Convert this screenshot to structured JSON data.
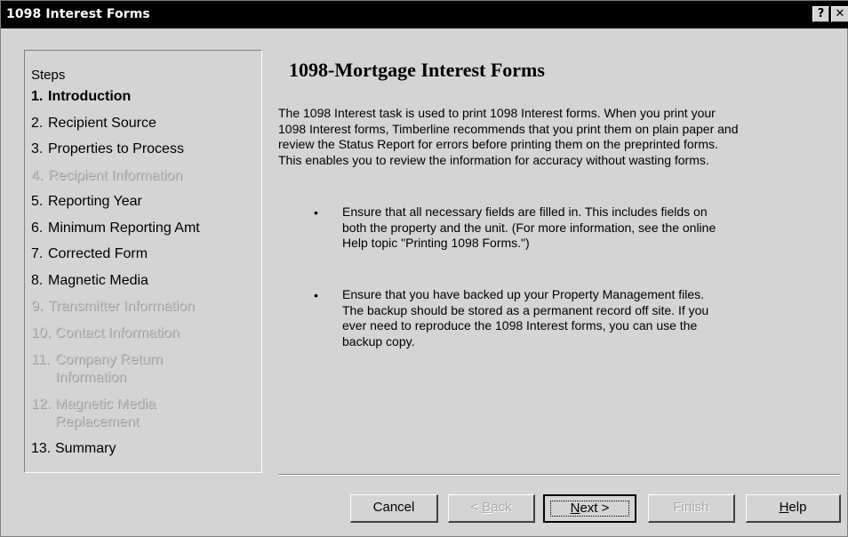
{
  "window": {
    "title": "1098 Interest Forms"
  },
  "titlebar_buttons": {
    "help": "?",
    "close": "✕"
  },
  "steps": {
    "heading": "Steps",
    "items": [
      {
        "num": "1.",
        "label": "Introduction",
        "state": "active"
      },
      {
        "num": "2.",
        "label": "Recipient Source",
        "state": "enabled"
      },
      {
        "num": "3.",
        "label": "Properties to Process",
        "state": "enabled"
      },
      {
        "num": "4.",
        "label": "Recipient Information",
        "state": "disabled"
      },
      {
        "num": "5.",
        "label": "Reporting Year",
        "state": "enabled"
      },
      {
        "num": "6.",
        "label": "Minimum Reporting Amt",
        "state": "enabled"
      },
      {
        "num": "7.",
        "label": "Corrected Form",
        "state": "enabled"
      },
      {
        "num": "8.",
        "label": "Magnetic Media",
        "state": "enabled"
      },
      {
        "num": "9.",
        "label": "Transmitter Information",
        "state": "disabled"
      },
      {
        "num": "10.",
        "label": "Contact Information",
        "state": "disabled"
      },
      {
        "num": "11.",
        "label": "Company Return",
        "label2": "Information",
        "state": "disabled"
      },
      {
        "num": "12.",
        "label": "Magnetic Media",
        "label2": "Replacement",
        "state": "disabled"
      },
      {
        "num": "13.",
        "label": "Summary",
        "state": "enabled"
      }
    ]
  },
  "content": {
    "title": "1098-Mortgage Interest Forms",
    "intro_lines": [
      "The 1098 Interest task is used to print 1098 Interest forms.  When you print your",
      "1098 Interest forms, Timberline recommends that you print them on plain paper and",
      "review the Status Report for errors before printing them on the preprinted forms.",
      "This enables you to review the information for accuracy without wasting forms."
    ],
    "bullets": [
      {
        "marker": "•",
        "lines": [
          "Ensure that all necessary fields are filled in.  This includes fields on",
          "both the property and the unit. (For more information, see the online",
          "Help topic \"Printing 1098 Forms.\")"
        ]
      },
      {
        "marker": "•",
        "lines": [
          "Ensure that you have backed up your Property Management files.",
          "The backup should be stored as a permanent record off site.  If you",
          "ever need to reproduce the 1098 Interest forms, you can use the",
          "backup copy."
        ]
      }
    ]
  },
  "buttons": {
    "cancel": "Cancel",
    "back": {
      "prefix": "< ",
      "hot": "B",
      "rest": "ack"
    },
    "next": {
      "hot": "N",
      "rest": "ext >"
    },
    "finish": "Finish",
    "help": {
      "hot": "H",
      "rest": "elp"
    }
  }
}
